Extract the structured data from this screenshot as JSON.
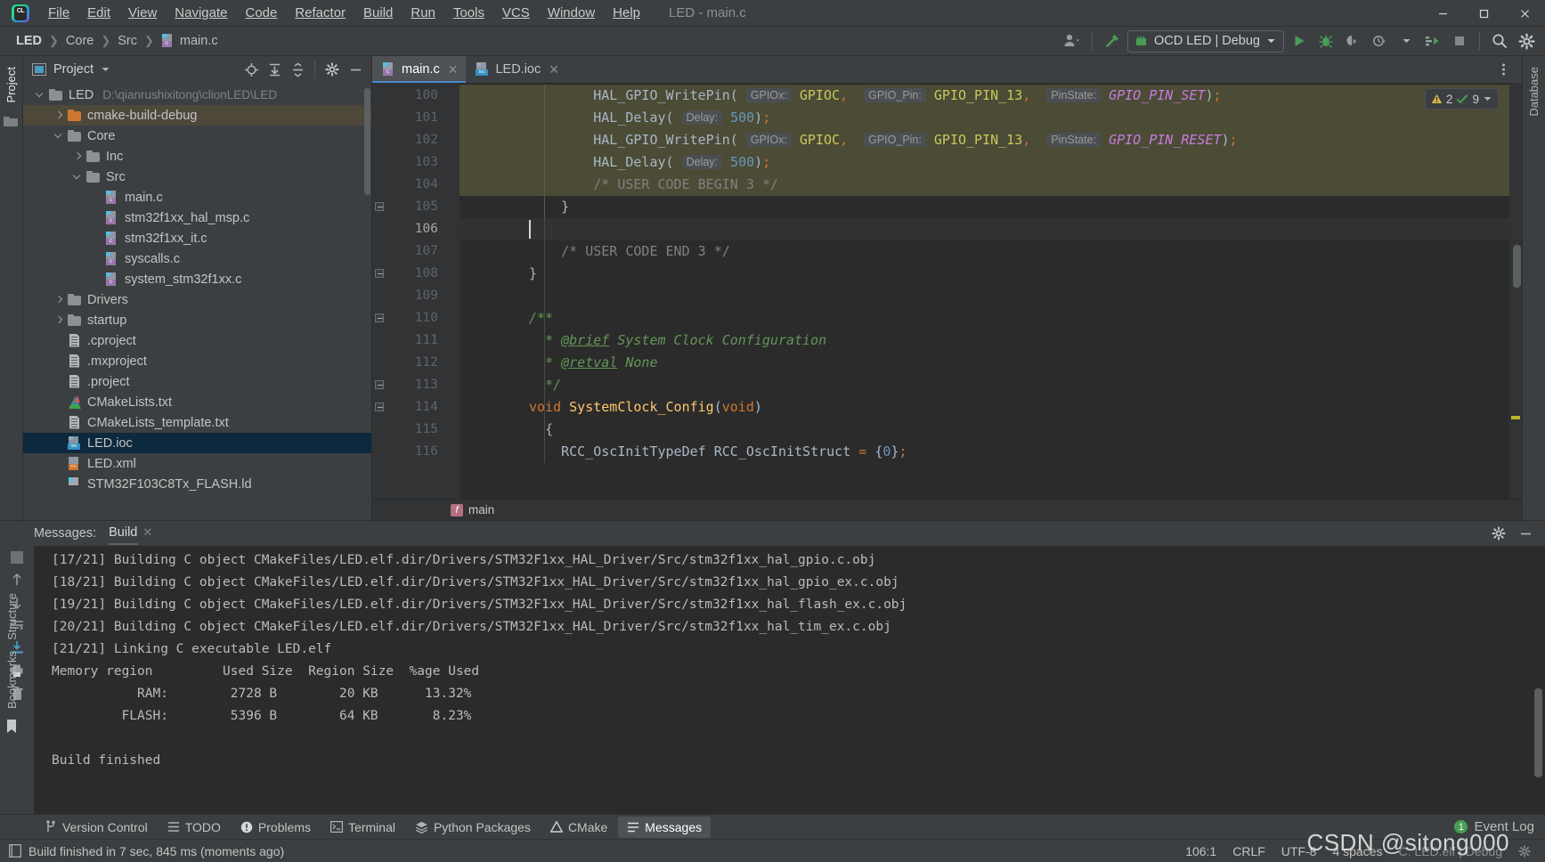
{
  "window": {
    "title": "LED - main.c",
    "controls": [
      "minimize",
      "maximize",
      "close"
    ]
  },
  "menu": [
    "File",
    "Edit",
    "View",
    "Navigate",
    "Code",
    "Refactor",
    "Build",
    "Run",
    "Tools",
    "VCS",
    "Window",
    "Help"
  ],
  "navbar": {
    "breadcrumb": [
      "LED",
      "Core",
      "Src",
      "main.c"
    ],
    "run_config": "OCD LED | Debug",
    "buttons": [
      "run",
      "debug",
      "attach",
      "profile",
      "run-with-coverage",
      "stop",
      "search",
      "settings"
    ]
  },
  "project_panel": {
    "title": "Project",
    "header_icons": [
      "locate-icon",
      "expand-all-icon",
      "collapse-all-icon",
      "gear-icon",
      "hide-icon"
    ],
    "tree": [
      {
        "label": "LED",
        "path": "D:\\qianrushixitong\\clionLED\\LED",
        "indent": 0,
        "icon": "folder",
        "chevron": "down",
        "state": ""
      },
      {
        "label": "cmake-build-debug",
        "path": "",
        "indent": 1,
        "icon": "folder-orange",
        "chevron": "right",
        "state": "highlight"
      },
      {
        "label": "Core",
        "path": "",
        "indent": 1,
        "icon": "folder",
        "chevron": "down",
        "state": ""
      },
      {
        "label": "Inc",
        "path": "",
        "indent": 2,
        "icon": "folder",
        "chevron": "right",
        "state": ""
      },
      {
        "label": "Src",
        "path": "",
        "indent": 2,
        "icon": "folder",
        "chevron": "down",
        "state": ""
      },
      {
        "label": "main.c",
        "path": "",
        "indent": 3,
        "icon": "c",
        "chevron": "",
        "state": ""
      },
      {
        "label": "stm32f1xx_hal_msp.c",
        "path": "",
        "indent": 3,
        "icon": "c",
        "chevron": "",
        "state": ""
      },
      {
        "label": "stm32f1xx_it.c",
        "path": "",
        "indent": 3,
        "icon": "c",
        "chevron": "",
        "state": ""
      },
      {
        "label": "syscalls.c",
        "path": "",
        "indent": 3,
        "icon": "c",
        "chevron": "",
        "state": ""
      },
      {
        "label": "system_stm32f1xx.c",
        "path": "",
        "indent": 3,
        "icon": "c",
        "chevron": "",
        "state": ""
      },
      {
        "label": "Drivers",
        "path": "",
        "indent": 1,
        "icon": "folder",
        "chevron": "right",
        "state": ""
      },
      {
        "label": "startup",
        "path": "",
        "indent": 1,
        "icon": "folder",
        "chevron": "right",
        "state": ""
      },
      {
        "label": ".cproject",
        "path": "",
        "indent": 1,
        "icon": "txt",
        "chevron": "",
        "state": ""
      },
      {
        "label": ".mxproject",
        "path": "",
        "indent": 1,
        "icon": "txt",
        "chevron": "",
        "state": ""
      },
      {
        "label": ".project",
        "path": "",
        "indent": 1,
        "icon": "txt",
        "chevron": "",
        "state": ""
      },
      {
        "label": "CMakeLists.txt",
        "path": "",
        "indent": 1,
        "icon": "cmake",
        "chevron": "",
        "state": ""
      },
      {
        "label": "CMakeLists_template.txt",
        "path": "",
        "indent": 1,
        "icon": "txt",
        "chevron": "",
        "state": ""
      },
      {
        "label": "LED.ioc",
        "path": "",
        "indent": 1,
        "icon": "ioc",
        "chevron": "",
        "state": "selected"
      },
      {
        "label": "LED.xml",
        "path": "",
        "indent": 1,
        "icon": "xml",
        "chevron": "",
        "state": ""
      },
      {
        "label": "STM32F103C8Tx_FLASH.ld",
        "path": "",
        "indent": 1,
        "icon": "ld",
        "chevron": "",
        "state": ""
      }
    ]
  },
  "left_strip": {
    "tabs": [
      "Project"
    ]
  },
  "right_strip": {
    "tabs": [
      "Database"
    ]
  },
  "far_left_bottom": {
    "tabs": [
      "Structure",
      "Bookmarks"
    ]
  },
  "editor": {
    "tabs": [
      {
        "label": "main.c",
        "icon": "c",
        "active": true
      },
      {
        "label": "LED.ioc",
        "icon": "ioc",
        "active": false
      }
    ],
    "inspection": {
      "warnings": "2",
      "checks": "9"
    },
    "breadcrumb": "main",
    "first_line": 100,
    "lines": [
      {
        "n": 100,
        "text": "        HAL_GPIO_WritePin( GPIOx: GPIOC,  GPIO_Pin: GPIO_PIN_13,  PinState: GPIO_PIN_SET);"
      },
      {
        "n": 101,
        "text": "        HAL_Delay( Delay: 500);"
      },
      {
        "n": 102,
        "text": "        HAL_GPIO_WritePin( GPIOx: GPIOC,  GPIO_Pin: GPIO_PIN_13,  PinState: GPIO_PIN_RESET);"
      },
      {
        "n": 103,
        "text": "        HAL_Delay( Delay: 500);"
      },
      {
        "n": 104,
        "text": "        /* USER CODE BEGIN 3 */"
      },
      {
        "n": 105,
        "text": "    }"
      },
      {
        "n": 106,
        "text": ""
      },
      {
        "n": 107,
        "text": "    /* USER CODE END 3 */"
      },
      {
        "n": 108,
        "text": "}"
      },
      {
        "n": 109,
        "text": ""
      },
      {
        "n": 110,
        "text": "/**"
      },
      {
        "n": 111,
        "text": "  * @brief System Clock Configuration"
      },
      {
        "n": 112,
        "text": "  * @retval None"
      },
      {
        "n": 113,
        "text": "  */"
      },
      {
        "n": 114,
        "text": "void SystemClock_Config(void)"
      },
      {
        "n": 115,
        "text": "{"
      },
      {
        "n": 116,
        "text": "    RCC_OscInitTypeDef RCC_OscInitStruct = {0};"
      }
    ]
  },
  "build_panel": {
    "title": "Messages:",
    "tab": "Build",
    "lines": [
      "[17/21] Building C object CMakeFiles/LED.elf.dir/Drivers/STM32F1xx_HAL_Driver/Src/stm32f1xx_hal_gpio.c.obj",
      "[18/21] Building C object CMakeFiles/LED.elf.dir/Drivers/STM32F1xx_HAL_Driver/Src/stm32f1xx_hal_gpio_ex.c.obj",
      "[19/21] Building C object CMakeFiles/LED.elf.dir/Drivers/STM32F1xx_HAL_Driver/Src/stm32f1xx_hal_flash_ex.c.obj",
      "[20/21] Building C object CMakeFiles/LED.elf.dir/Drivers/STM32F1xx_HAL_Driver/Src/stm32f1xx_hal_tim_ex.c.obj",
      "[21/21] Linking C executable LED.elf",
      "Memory region         Used Size  Region Size  %age Used",
      "           RAM:        2728 B        20 KB      13.32%",
      "         FLASH:        5396 B        64 KB       8.23%",
      "",
      "Build finished"
    ]
  },
  "tool_window_bar": {
    "items": [
      {
        "label": "Version Control",
        "icon": "branch-icon",
        "active": false
      },
      {
        "label": "TODO",
        "icon": "list-icon",
        "active": false
      },
      {
        "label": "Problems",
        "icon": "warning-icon",
        "active": false
      },
      {
        "label": "Terminal",
        "icon": "terminal-icon",
        "active": false
      },
      {
        "label": "Python Packages",
        "icon": "layers-icon",
        "active": false
      },
      {
        "label": "CMake",
        "icon": "cmake-icon",
        "active": false
      },
      {
        "label": "Messages",
        "icon": "messages-icon",
        "active": true
      }
    ],
    "event_log": {
      "label": "Event Log",
      "count": "1"
    }
  },
  "statusbar": {
    "message": "Build finished in 7 sec, 845 ms (moments ago)",
    "caret": "106:1",
    "line_separator": "CRLF",
    "encoding": "UTF-8",
    "indent": "4 spaces",
    "target": "C: LED.elf | Debug"
  },
  "watermark": "CSDN @sitong000",
  "colors": {
    "accent_blue": "#4a88c7",
    "green": "#499c54",
    "warning_yellow": "#d6b24a",
    "selection_blue": "#0d293e",
    "highlight_brown": "#4e483b"
  }
}
